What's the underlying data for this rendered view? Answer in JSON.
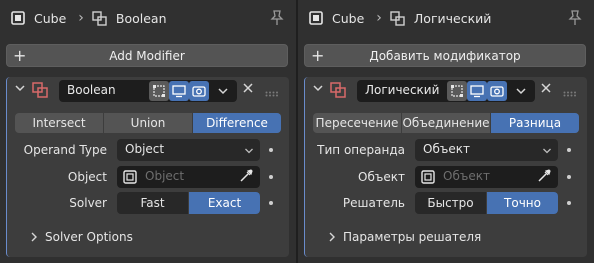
{
  "colors": {
    "accent": "#4772b3",
    "panel_bg": "#303030",
    "card_bg": "#3d3d3d",
    "field_bg": "#282828"
  },
  "panels": [
    {
      "id": "en",
      "header": {
        "object_name": "Cube",
        "modifier_name": "Boolean",
        "object_icon": "object-cube-icon",
        "modifier_icon": "boolean-modifier-icon"
      },
      "add_modifier_label": "Add Modifier",
      "modifier": {
        "name": "Boolean",
        "operations": [
          "Intersect",
          "Union",
          "Difference"
        ],
        "active_operation": 2,
        "operand_type_label": "Operand Type",
        "operand_type_value": "Object",
        "object_label": "Object",
        "object_placeholder": "Object",
        "solver_label": "Solver",
        "solver_options": [
          "Fast",
          "Exact"
        ],
        "active_solver": 1,
        "solver_options_panel": "Solver Options"
      }
    },
    {
      "id": "ru",
      "header": {
        "object_name": "Cube",
        "modifier_name": "Логический",
        "object_icon": "object-cube-icon",
        "modifier_icon": "boolean-modifier-icon"
      },
      "add_modifier_label": "Добавить модификатор",
      "modifier": {
        "name": "Логический",
        "operations": [
          "Пересечение",
          "Объединение",
          "Разница"
        ],
        "active_operation": 2,
        "operand_type_label": "Тип операнда",
        "operand_type_value": "Объект",
        "object_label": "Объект",
        "object_placeholder": "Объект",
        "solver_label": "Решатель",
        "solver_options": [
          "Быстро",
          "Точно"
        ],
        "active_solver": 1,
        "solver_options_panel": "Параметры решателя"
      }
    }
  ]
}
